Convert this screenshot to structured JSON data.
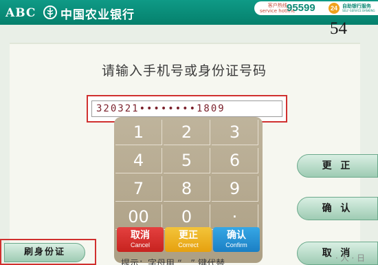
{
  "header": {
    "logo_text_en": "ABC",
    "logo_text_cn": "中国农业银行",
    "hotline_label": "客户热线\nservice hotline",
    "hotline_number": "95599",
    "badge": "24",
    "service_cn": "自助银行服务",
    "service_en": "SELF-SERVICE BANKING",
    "brand_color": "#0a8d78"
  },
  "screen": {
    "counter": "54",
    "prompt": "请输入手机号或身份证号码",
    "id_value": "320321••••••••1809",
    "hint": "提示：字母用 “ . ” 键代替"
  },
  "keypad": {
    "keys": [
      "1",
      "2",
      "3",
      "4",
      "5",
      "6",
      "7",
      "8",
      "9",
      "00",
      "0",
      "·"
    ],
    "cancel": {
      "cn": "取消",
      "en": "Cancel",
      "color": "#d9302d"
    },
    "correct": {
      "cn": "更正",
      "en": "Correct",
      "color": "#eeb41e"
    },
    "confirm": {
      "cn": "确认",
      "en": "Confirm",
      "color": "#2a96d8"
    }
  },
  "side_buttons": {
    "right": [
      {
        "label": "更 正"
      },
      {
        "label": "确 认"
      },
      {
        "label": "取 消"
      }
    ],
    "left": [
      {
        "label": "刷身份证"
      }
    ]
  },
  "watermark": "· 人 · 日"
}
